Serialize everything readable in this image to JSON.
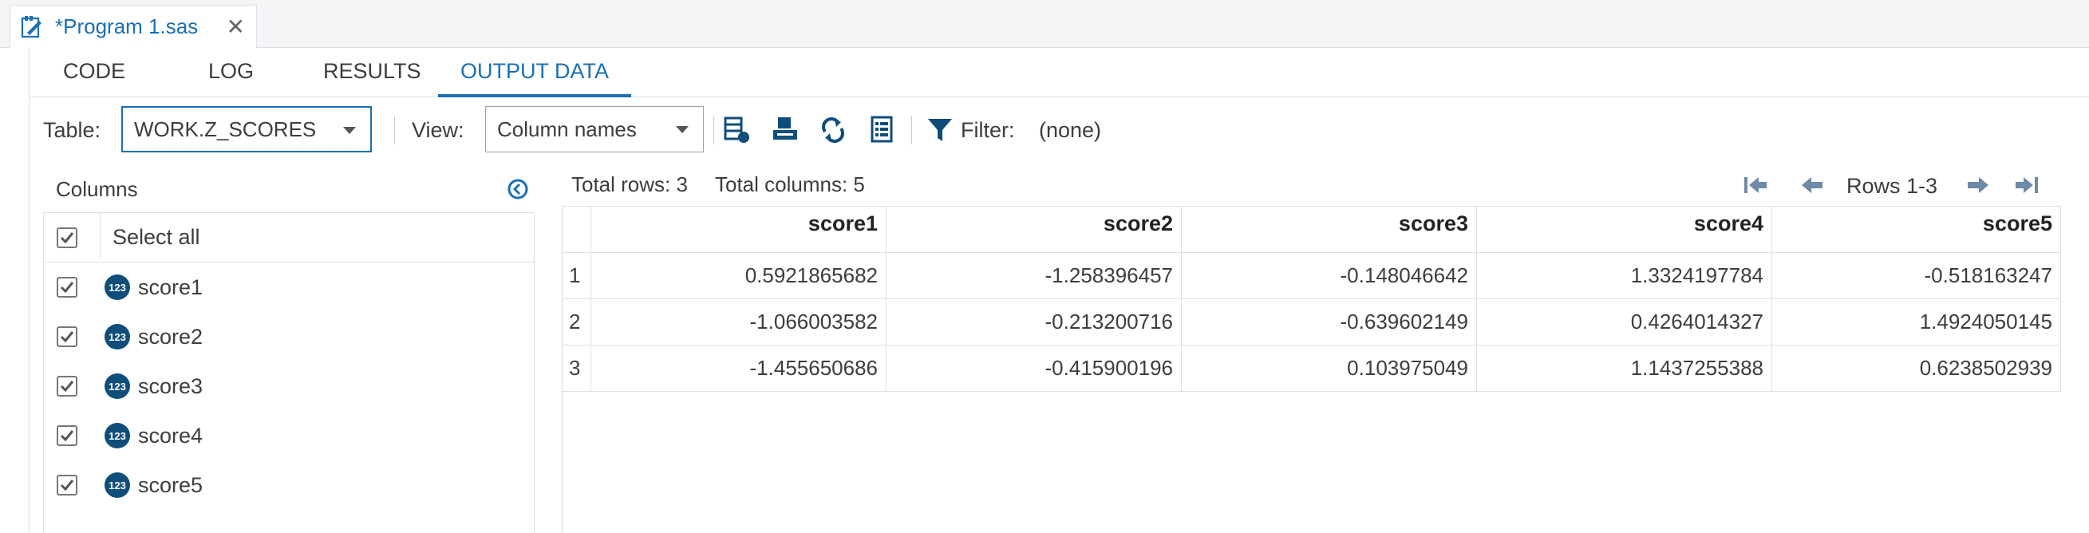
{
  "file_tab": {
    "title": "*Program 1.sas",
    "close": "✕"
  },
  "view_tabs": [
    {
      "label": "CODE"
    },
    {
      "label": "LOG"
    },
    {
      "label": "RESULTS"
    },
    {
      "label": "OUTPUT DATA",
      "active": true
    }
  ],
  "toolbar": {
    "table_label": "Table:",
    "table_value": "WORK.Z_SCORES",
    "view_label": "View:",
    "view_value": "Column names",
    "filter_label": "Filter:",
    "filter_value": "(none)"
  },
  "columns_panel": {
    "title": "Columns",
    "select_all": "Select all",
    "badge": "123",
    "columns": [
      "score1",
      "score2",
      "score3",
      "score4",
      "score5"
    ]
  },
  "grid": {
    "total_rows": "Total rows: 3",
    "total_columns": "Total columns: 5",
    "rows_range": "Rows 1-3",
    "headers": [
      "score1",
      "score2",
      "score3",
      "score4",
      "score5"
    ],
    "rows": [
      {
        "n": "1",
        "cells": [
          "0.5921865682",
          "-1.258396457",
          "-0.148046642",
          "1.3324197784",
          "-0.518163247"
        ]
      },
      {
        "n": "2",
        "cells": [
          "-1.066003582",
          "-0.213200716",
          "-0.639602149",
          "0.4264014327",
          "1.4924050145"
        ]
      },
      {
        "n": "3",
        "cells": [
          "-1.455650686",
          "-0.415900196",
          "0.103975049",
          "1.1437255388",
          "0.6238502939"
        ]
      }
    ]
  },
  "colors": {
    "accent": "#1a6fb3",
    "badge": "#0f4d7a",
    "border": "#dcdfe3"
  }
}
